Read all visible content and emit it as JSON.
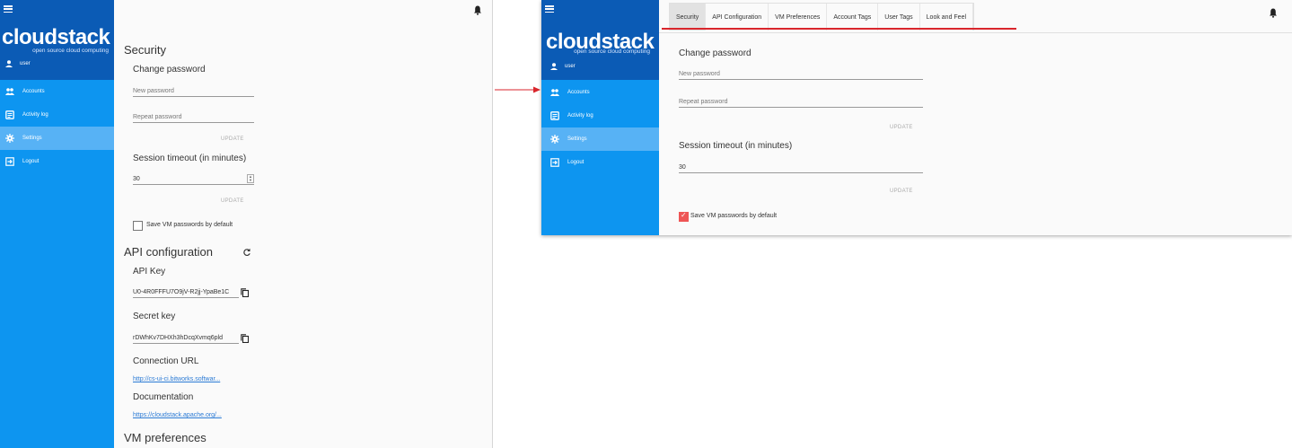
{
  "left": {
    "sidebar": {
      "brand": "cloudstack",
      "tagline": "open source cloud computing",
      "user": "user",
      "nav": [
        {
          "label": "Accounts",
          "icon": "accounts-icon",
          "active": false
        },
        {
          "label": "Activity log",
          "icon": "activity-log-icon",
          "active": false
        },
        {
          "label": "Settings",
          "icon": "gear-icon",
          "active": true
        },
        {
          "label": "Logout",
          "icon": "logout-icon",
          "active": false
        }
      ]
    },
    "security": {
      "title": "Security",
      "change_password": "Change password",
      "new_password_placeholder": "New password",
      "repeat_password_placeholder": "Repeat password",
      "update_label": "UPDATE",
      "session_timeout_label": "Session timeout (in minutes)",
      "session_timeout_value": "30",
      "update2_label": "UPDATE",
      "save_vm_passwords_label": "Save VM passwords by default",
      "save_vm_passwords_checked": false
    },
    "api": {
      "title": "API configuration",
      "api_key_label": "API Key",
      "api_key_value": "U0-4R0FFFU7O9jV-R2jj-YpaBe1C",
      "secret_key_label": "Secret key",
      "secret_key_value": "rDWhKv7DHXh3hDcqXvmq6pld",
      "connection_url_label": "Connection URL",
      "connection_url": "http://cs-ui-ci.bitworks.softwar...",
      "documentation_label": "Documentation",
      "documentation_url": "https://cloudstack.apache.org/..."
    },
    "vm_prefs_title": "VM preferences"
  },
  "right": {
    "sidebar": {
      "brand": "cloudstack",
      "tagline": "open source cloud computing",
      "user": "user",
      "nav": [
        {
          "label": "Accounts"
        },
        {
          "label": "Activity log"
        },
        {
          "label": "Settings"
        },
        {
          "label": "Logout"
        }
      ]
    },
    "tabs": [
      "Security",
      "API Configuration",
      "VM Preferences",
      "Account Tags",
      "User Tags",
      "Look and Feel"
    ],
    "active_tab": "Security",
    "change_password": "Change password",
    "new_password_placeholder": "New password",
    "repeat_password_placeholder": "Repeat password",
    "update_label": "UPDATE",
    "session_timeout_label": "Session timeout (in minutes)",
    "session_timeout_value": "30",
    "update2_label": "UPDATE",
    "save_vm_passwords_label": "Save VM passwords by default",
    "save_vm_passwords_checked": true
  },
  "colors": {
    "sidebar_header": "#0b5bb5",
    "sidebar": "#0d95f0",
    "sidebar_active": "#57b2f5",
    "link": "#2a7ad5",
    "annotation_red": "#d9262c"
  }
}
